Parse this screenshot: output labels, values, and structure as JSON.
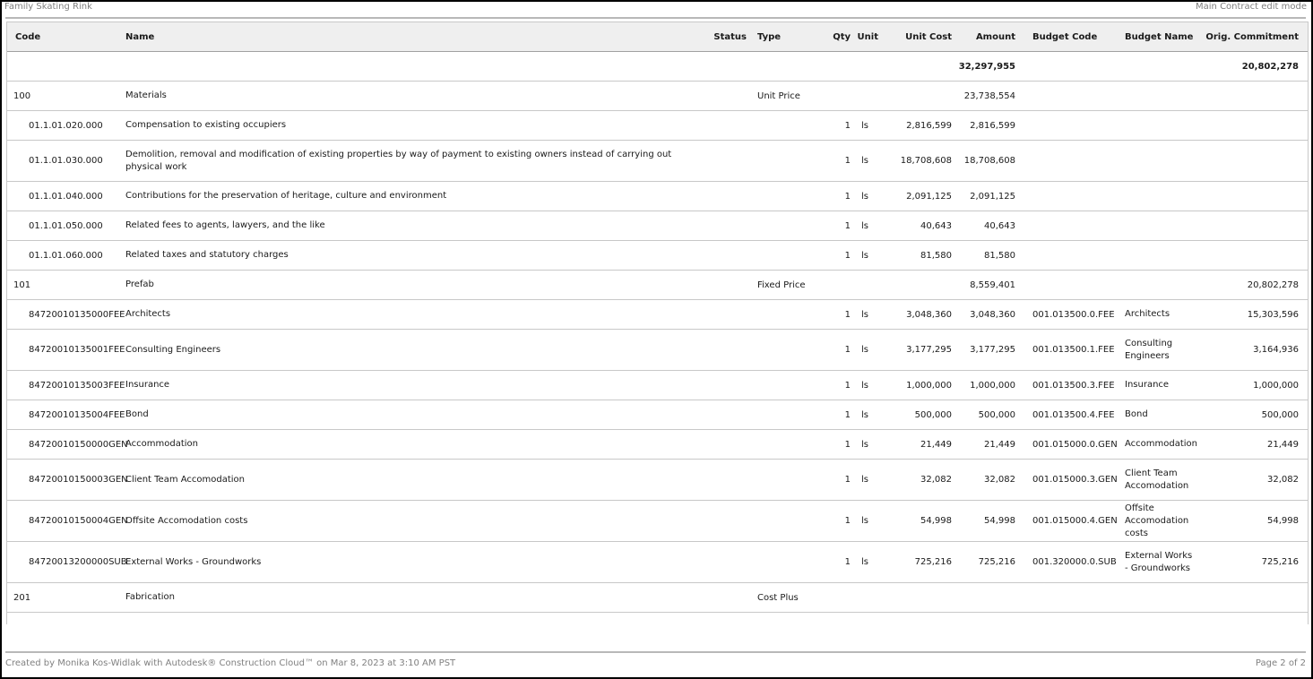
{
  "header": {
    "title": "Family Skating Rink",
    "mode": "Main Contract edit mode"
  },
  "table": {
    "columns": {
      "code": "Code",
      "name": "Name",
      "status": "Status",
      "type": "Type",
      "qty": "Qty",
      "unit": "Unit",
      "unit_cost": "Unit Cost",
      "amount": "Amount",
      "budget_code": "Budget Code",
      "budget_name": "Budget Name",
      "orig_commitment": "Orig. Commitment"
    },
    "total": {
      "amount": "32,297,955",
      "orig_commitment": "20,802,278"
    },
    "rows": [
      {
        "kind": "group",
        "code": "100",
        "name": "Materials",
        "type": "Unit Price",
        "amount": "23,738,554"
      },
      {
        "kind": "item",
        "code": "01.1.01.020.000",
        "name": "Compensation to existing occupiers",
        "qty": "1",
        "unit": "ls",
        "unit_cost": "2,816,599",
        "amount": "2,816,599"
      },
      {
        "kind": "item",
        "tall": true,
        "code": "01.1.01.030.000",
        "name": "Demolition, removal and modification of existing properties by way of payment to existing owners instead of carrying out physical work",
        "qty": "1",
        "unit": "ls",
        "unit_cost": "18,708,608",
        "amount": "18,708,608"
      },
      {
        "kind": "item",
        "code": "01.1.01.040.000",
        "name": "Contributions for the preservation of heritage, culture and environment",
        "qty": "1",
        "unit": "ls",
        "unit_cost": "2,091,125",
        "amount": "2,091,125"
      },
      {
        "kind": "item",
        "code": "01.1.01.050.000",
        "name": "Related fees to agents, lawyers, and the like",
        "qty": "1",
        "unit": "ls",
        "unit_cost": "40,643",
        "amount": "40,643"
      },
      {
        "kind": "item",
        "code": "01.1.01.060.000",
        "name": "Related taxes and statutory charges",
        "qty": "1",
        "unit": "ls",
        "unit_cost": "81,580",
        "amount": "81,580"
      },
      {
        "kind": "group",
        "code": "101",
        "name": "Prefab",
        "type": "Fixed Price",
        "amount": "8,559,401",
        "orig_commitment": "20,802,278"
      },
      {
        "kind": "item",
        "code": "84720010135000FEE",
        "name": "Architects",
        "qty": "1",
        "unit": "ls",
        "unit_cost": "3,048,360",
        "amount": "3,048,360",
        "budget_code": "001.013500.0.FEE",
        "budget_name": "Architects",
        "orig_commitment": "15,303,596"
      },
      {
        "kind": "item",
        "tall": true,
        "code": "84720010135001FEE",
        "name": "Consulting Engineers",
        "qty": "1",
        "unit": "ls",
        "unit_cost": "3,177,295",
        "amount": "3,177,295",
        "budget_code": "001.013500.1.FEE",
        "budget_name": "Consulting Engineers",
        "orig_commitment": "3,164,936"
      },
      {
        "kind": "item",
        "code": "84720010135003FEE",
        "name": "Insurance",
        "qty": "1",
        "unit": "ls",
        "unit_cost": "1,000,000",
        "amount": "1,000,000",
        "budget_code": "001.013500.3.FEE",
        "budget_name": "Insurance",
        "orig_commitment": "1,000,000"
      },
      {
        "kind": "item",
        "code": "84720010135004FEE",
        "name": "Bond",
        "qty": "1",
        "unit": "ls",
        "unit_cost": "500,000",
        "amount": "500,000",
        "budget_code": "001.013500.4.FEE",
        "budget_name": "Bond",
        "orig_commitment": "500,000"
      },
      {
        "kind": "item",
        "code": "84720010150000GEN",
        "name": "Accommodation",
        "qty": "1",
        "unit": "ls",
        "unit_cost": "21,449",
        "amount": "21,449",
        "budget_code": "001.015000.0.GEN",
        "budget_name": "Accommodation",
        "orig_commitment": "21,449"
      },
      {
        "kind": "item",
        "tall": true,
        "code": "84720010150003GEN",
        "name": "Client Team Accomodation",
        "qty": "1",
        "unit": "ls",
        "unit_cost": "32,082",
        "amount": "32,082",
        "budget_code": "001.015000.3.GEN",
        "budget_name": "Client Team Accomodation",
        "orig_commitment": "32,082"
      },
      {
        "kind": "item",
        "tall": true,
        "code": "84720010150004GEN",
        "name": "Offsite Accomodation costs",
        "qty": "1",
        "unit": "ls",
        "unit_cost": "54,998",
        "amount": "54,998",
        "budget_code": "001.015000.4.GEN",
        "budget_name": "Offsite Accomodation costs",
        "orig_commitment": "54,998"
      },
      {
        "kind": "item",
        "tall": true,
        "code": "84720013200000SUB",
        "name": "External Works - Groundworks",
        "qty": "1",
        "unit": "ls",
        "unit_cost": "725,216",
        "amount": "725,216",
        "budget_code": "001.320000.0.SUB",
        "budget_name": "External Works - Groundworks",
        "orig_commitment": "725,216"
      },
      {
        "kind": "group",
        "code": "201",
        "name": "Fabrication",
        "type": "Cost Plus"
      }
    ]
  },
  "footer": {
    "created": "Created by Monika Kos-Widlak with Autodesk® Construction Cloud™ on Mar 8, 2023 at 3:10 AM PST",
    "page": "Page 2 of 2"
  }
}
